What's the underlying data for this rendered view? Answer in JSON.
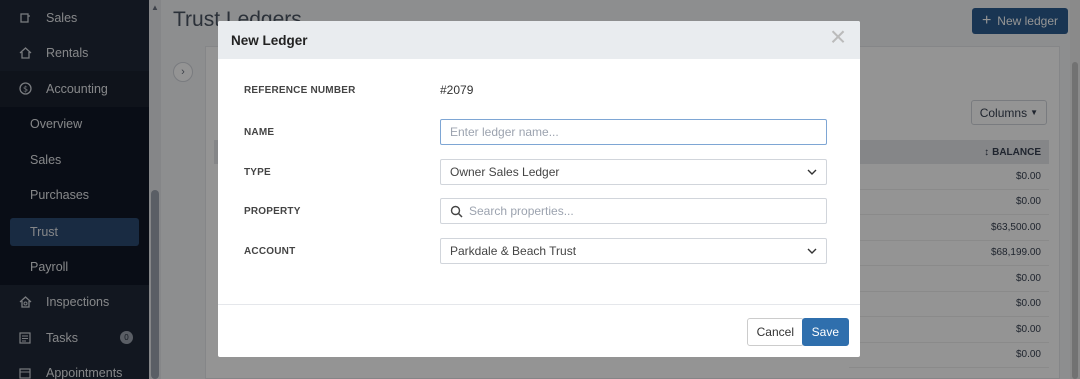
{
  "sidebar": {
    "items": [
      {
        "label": "Sales",
        "icon": "receipt-icon"
      },
      {
        "label": "Rentals",
        "icon": "house-icon"
      },
      {
        "label": "Accounting",
        "icon": "dollar-circle-icon"
      }
    ],
    "accounting_sub": [
      {
        "label": "Overview"
      },
      {
        "label": "Sales"
      },
      {
        "label": "Purchases"
      },
      {
        "label": "Trust"
      },
      {
        "label": "Payroll"
      }
    ],
    "bottom_items": [
      {
        "label": "Inspections",
        "icon": "inspection-icon"
      },
      {
        "label": "Tasks",
        "icon": "tasks-icon",
        "badge": "0"
      },
      {
        "label": "Appointments",
        "icon": "calendar-icon"
      }
    ]
  },
  "page": {
    "title": "Trust Ledgers",
    "new_ledger_label": "New ledger",
    "columns_label": "Columns",
    "balance_header": "BALANCE",
    "balances": [
      "$0.00",
      "$0.00",
      "$63,500.00",
      "$68,199.00",
      "$0.00",
      "$0.00",
      "$0.00",
      "$0.00"
    ]
  },
  "modal": {
    "title": "New Ledger",
    "reference_label": "REFERENCE NUMBER",
    "reference_value": "#2079",
    "name_label": "NAME",
    "name_placeholder": "Enter ledger name...",
    "type_label": "TYPE",
    "type_value": "Owner Sales Ledger",
    "property_label": "PROPERTY",
    "property_placeholder": "Search properties...",
    "account_label": "ACCOUNT",
    "account_value": "Parkdale & Beach Trust",
    "cancel_label": "Cancel",
    "save_label": "Save"
  },
  "colors": {
    "sidebar_bg": "#1f2937",
    "active_item": "#2b4a73",
    "primary_button": "#2f6fad"
  }
}
